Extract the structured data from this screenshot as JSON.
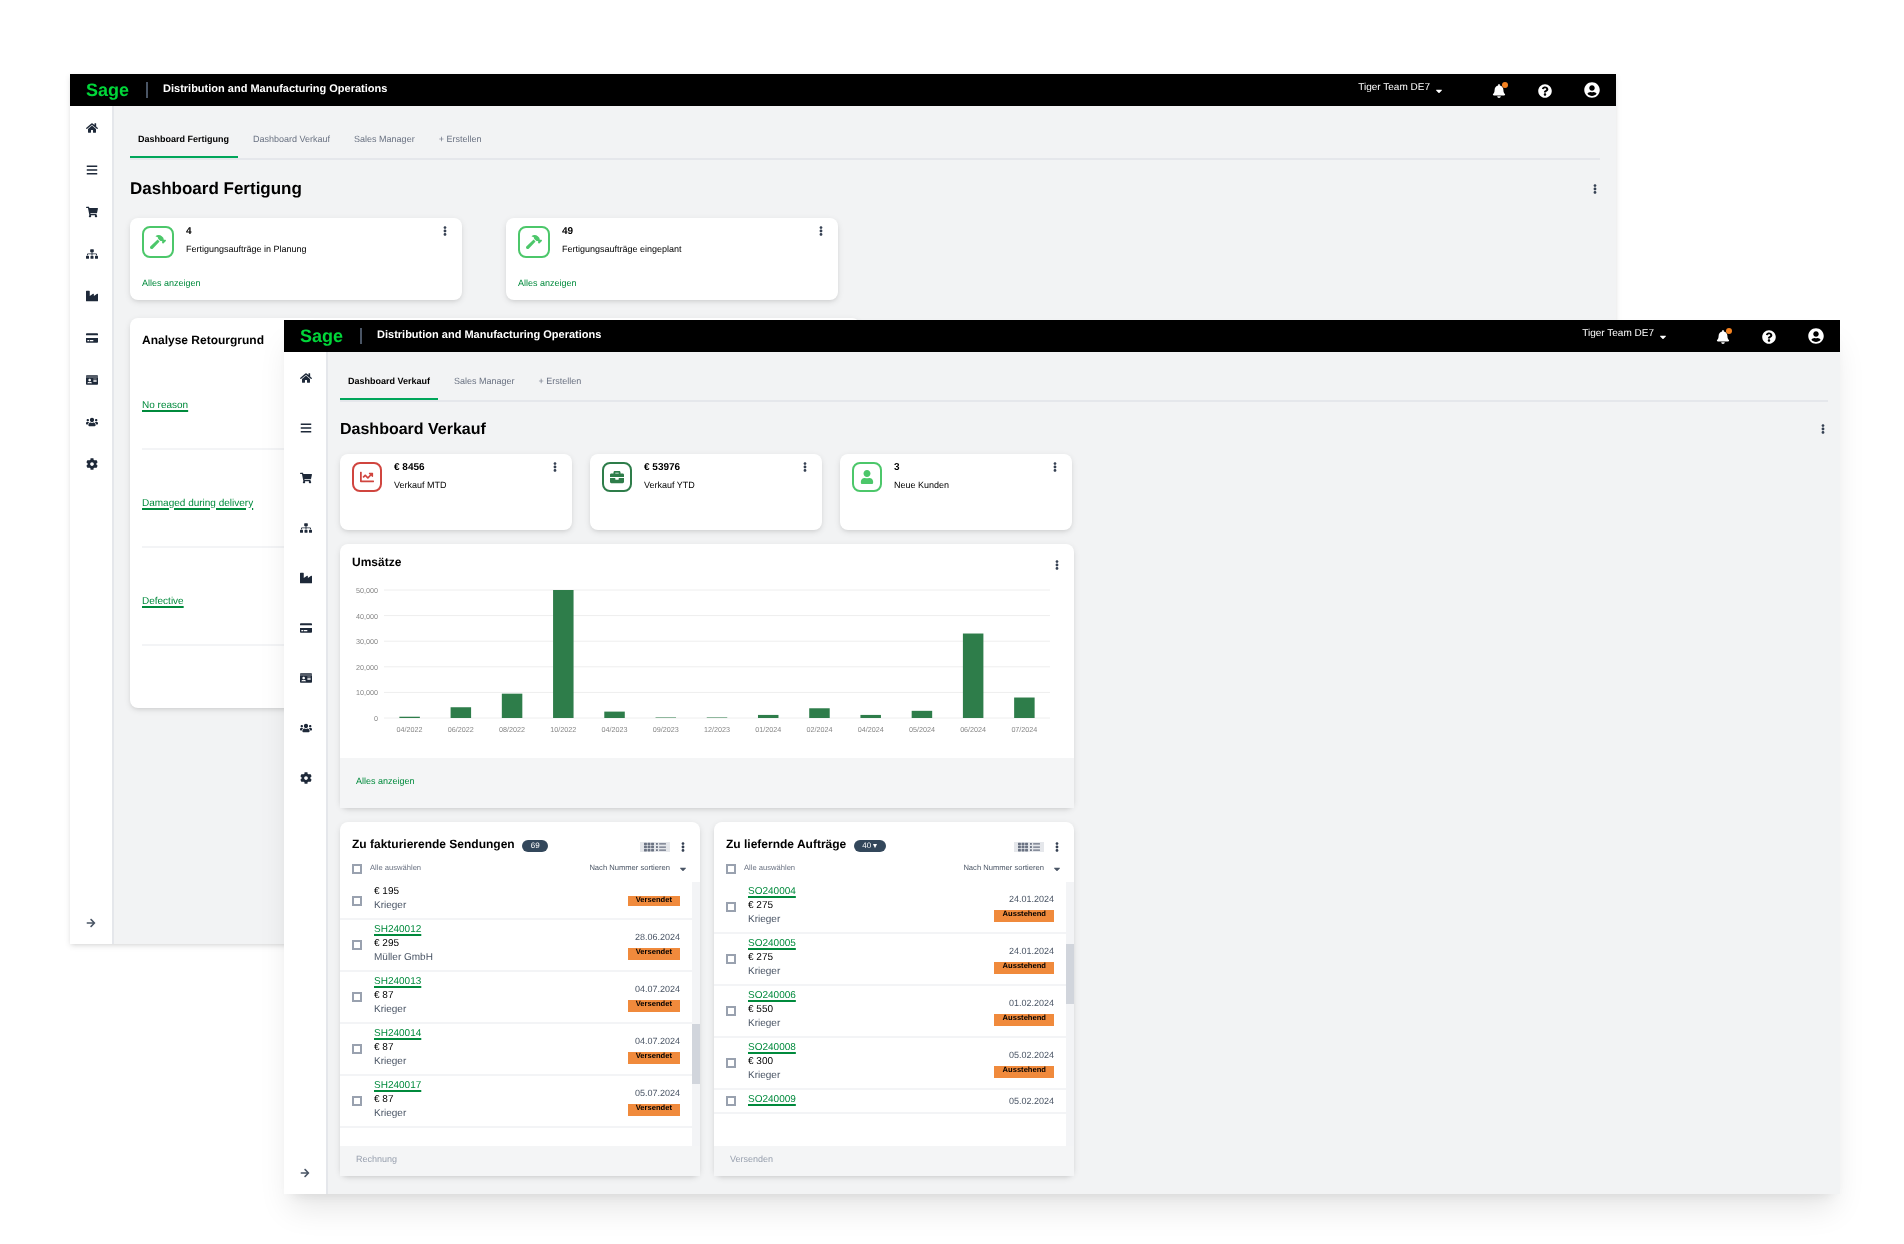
{
  "back_window": {
    "header": {
      "logo": "Sage",
      "title": "Distribution and Manufacturing Operations",
      "team": "Tiger Team DE7"
    },
    "tabs": [
      {
        "label": "Dashboard Fertigung",
        "selected": true
      },
      {
        "label": "Dashboard Verkauf",
        "selected": false
      },
      {
        "label": "Sales Manager",
        "selected": false
      },
      {
        "label": "+ Erstellen",
        "selected": false
      }
    ],
    "page_title": "Dashboard Fertigung",
    "kpi_cards": [
      {
        "value": "4",
        "label": "Fertigungsaufträge in Planung",
        "link": "Alles anzeigen"
      },
      {
        "value": "49",
        "label": "Fertigungsaufträge eingeplant",
        "link": "Alles anzeigen"
      }
    ],
    "return_reasons": {
      "title": "Analyse Retourgrund",
      "links": [
        "No reason",
        "Damaged during delivery",
        "Defective"
      ]
    }
  },
  "front_window": {
    "header": {
      "logo": "Sage",
      "title": "Distribution and Manufacturing Operations",
      "team": "Tiger Team DE7"
    },
    "tabs": [
      {
        "label": "Dashboard Verkauf",
        "selected": true
      },
      {
        "label": "Sales Manager",
        "selected": false
      },
      {
        "label": "+ Erstellen",
        "selected": false
      }
    ],
    "page_title": "Dashboard Verkauf",
    "kpi_cards": [
      {
        "value": "€ 8456",
        "label": "Verkauf MTD",
        "color": "#d0453f"
      },
      {
        "value": "€ 53976",
        "label": "Verkauf YTD",
        "color": "#2e7d4a"
      },
      {
        "value": "3",
        "label": "Neue Kunden",
        "color": "#4cc76a"
      }
    ],
    "sales_card": {
      "title": "Umsätze",
      "link": "Alles anzeigen",
      "chart_data": {
        "type": "bar",
        "categories": [
          "04/2022",
          "06/2022",
          "08/2022",
          "10/2022",
          "04/2023",
          "09/2023",
          "12/2023",
          "01/2024",
          "02/2024",
          "04/2024",
          "05/2024",
          "06/2024",
          "07/2024"
        ],
        "grid": true,
        "series": [
          {
            "color": "#2e7d4a",
            "values": [
              500,
              4200,
              9500,
              50000,
              2500,
              200,
              200,
              1200,
              3800,
              1200,
              2800,
              33000,
              8000
            ]
          }
        ],
        "ylim": [
          0,
          50000
        ],
        "yticks": [
          {
            "value": 0,
            "label": "0"
          },
          {
            "value": 10000,
            "label": "10,000"
          },
          {
            "value": 20000,
            "label": "20,000"
          },
          {
            "value": 30000,
            "label": "30,000"
          },
          {
            "value": 40000,
            "label": "40,000"
          },
          {
            "value": 50000,
            "label": "50,000"
          }
        ]
      }
    },
    "lists": [
      {
        "title": "Zu fakturierende Sendungen",
        "count": "69",
        "select_all": "Alle auswählen",
        "all_checked": false,
        "sort": "Nach Nummer sortieren",
        "footer_action": "Rechnung",
        "items": [
          {
            "amount": "€ 195",
            "customer": "Krieger",
            "status": "Versendet",
            "checked": false
          },
          {
            "id": "SH240012",
            "date": "28.06.2024",
            "amount": "€ 295",
            "customer": "Müller GmbH",
            "status": "Versendet",
            "checked": false
          },
          {
            "id": "SH240013",
            "date": "04.07.2024",
            "amount": "€ 87",
            "customer": "Krieger",
            "status": "Versendet",
            "checked": false
          },
          {
            "id": "SH240014",
            "date": "04.07.2024",
            "amount": "€ 87",
            "customer": "Krieger",
            "status": "Versendet",
            "checked": false
          },
          {
            "id": "SH240017",
            "date": "05.07.2024",
            "amount": "€ 87",
            "customer": "Krieger",
            "status": "Versendet",
            "checked": false
          }
        ]
      },
      {
        "title": "Zu liefernde Aufträge",
        "count": "40 ▾",
        "select_all": "Alle auswählen",
        "all_checked": false,
        "sort": "Nach Nummer sortieren",
        "footer_action": "Versenden",
        "items": [
          {
            "id": "SO240004",
            "date": "24.01.2024",
            "amount": "€ 275",
            "customer": "Krieger",
            "status": "Ausstehend",
            "checked": false
          },
          {
            "id": "SO240005",
            "date": "24.01.2024",
            "amount": "€ 275",
            "customer": "Krieger",
            "status": "Ausstehend",
            "checked": false
          },
          {
            "id": "SO240006",
            "date": "01.02.2024",
            "amount": "€ 550",
            "customer": "Krieger",
            "status": "Ausstehend",
            "checked": false
          },
          {
            "id": "SO240008",
            "date": "05.02.2024",
            "amount": "€ 300",
            "customer": "Krieger",
            "status": "Ausstehend",
            "checked": false
          },
          {
            "id": "SO240009",
            "date": "05.02.2024",
            "checked": false
          }
        ]
      }
    ]
  }
}
